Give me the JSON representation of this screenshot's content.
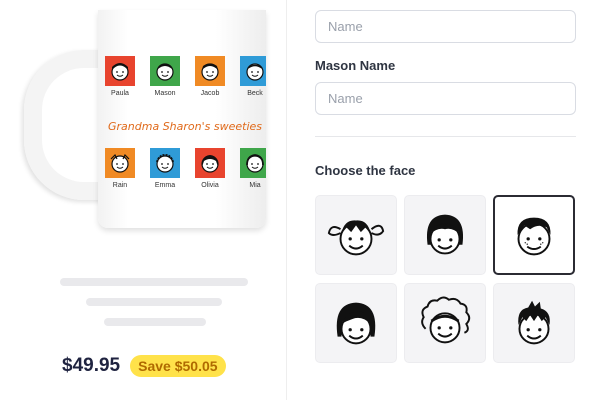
{
  "mug": {
    "caption": "Grandma Sharon's sweeties",
    "top_row": [
      {
        "name": "Paula",
        "color": "#e8442e"
      },
      {
        "name": "Mason",
        "color": "#3fa64a"
      },
      {
        "name": "Jacob",
        "color": "#f08a24"
      },
      {
        "name": "Beck",
        "color": "#2f9bd7"
      }
    ],
    "bottom_row": [
      {
        "name": "Rain",
        "color": "#f08a24"
      },
      {
        "name": "Emma",
        "color": "#2f9bd7"
      },
      {
        "name": "Olivia",
        "color": "#e8442e"
      },
      {
        "name": "Mia",
        "color": "#3fa64a"
      }
    ]
  },
  "pricing": {
    "price": "$49.95",
    "save_label": "Save $50.05"
  },
  "form": {
    "name_field_1": {
      "placeholder": "Name"
    },
    "mason_label": "Mason Name",
    "name_field_2": {
      "placeholder": "Name"
    },
    "faces_heading": "Choose the face"
  },
  "faces": [
    {
      "icon": "face-pigtails-icon",
      "selected": false
    },
    {
      "icon": "face-bob-bangs-icon",
      "selected": false
    },
    {
      "icon": "face-freckles-boy-icon",
      "selected": true
    },
    {
      "icon": "face-side-part-icon",
      "selected": false
    },
    {
      "icon": "face-curly-headband-icon",
      "selected": false
    },
    {
      "icon": "face-spiky-boy-icon",
      "selected": false
    }
  ],
  "colors": {
    "accent_yellow": "#ffe24a",
    "price_text": "#1f2340",
    "caption_orange": "#e06a1b"
  }
}
